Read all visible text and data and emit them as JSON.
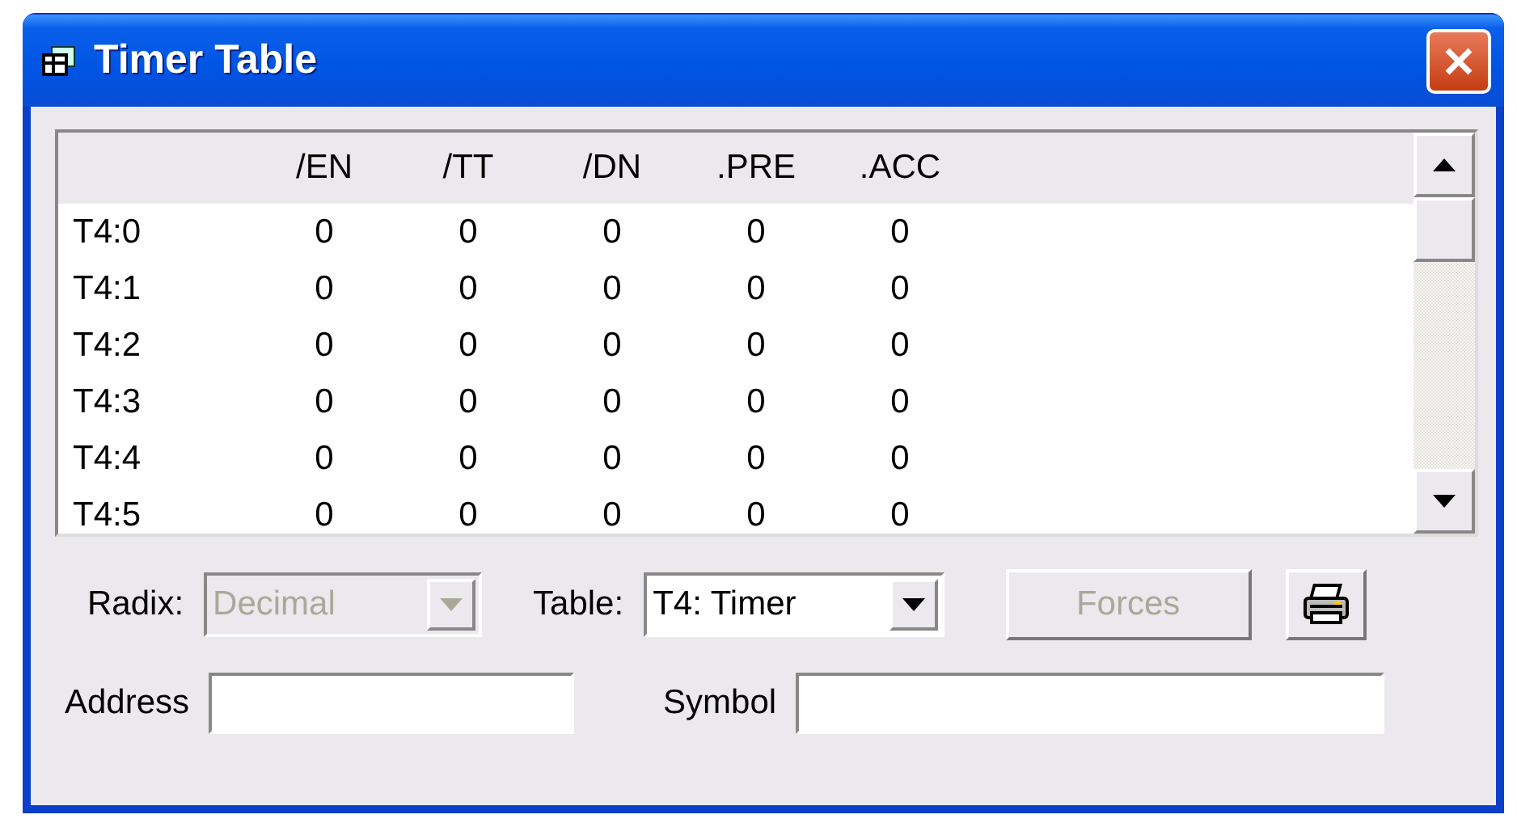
{
  "window": {
    "title": "Timer Table"
  },
  "table": {
    "columns": [
      "/EN",
      "/TT",
      "/DN",
      ".PRE",
      ".ACC"
    ],
    "rows": [
      {
        "address": "T4:0",
        "cells": [
          "0",
          "0",
          "0",
          "0",
          "0"
        ]
      },
      {
        "address": "T4:1",
        "cells": [
          "0",
          "0",
          "0",
          "0",
          "0"
        ]
      },
      {
        "address": "T4:2",
        "cells": [
          "0",
          "0",
          "0",
          "0",
          "0"
        ]
      },
      {
        "address": "T4:3",
        "cells": [
          "0",
          "0",
          "0",
          "0",
          "0"
        ]
      },
      {
        "address": "T4:4",
        "cells": [
          "0",
          "0",
          "0",
          "0",
          "0"
        ]
      },
      {
        "address": "T4:5",
        "cells": [
          "0",
          "0",
          "0",
          "0",
          "0"
        ]
      }
    ]
  },
  "controls": [
    {
      "kind": "dropdown",
      "label": "Radix:",
      "value": "Decimal",
      "disabled": true
    },
    {
      "kind": "dropdown",
      "label": "Table:",
      "value": "T4: Timer",
      "disabled": false
    },
    {
      "kind": "button",
      "label": "Forces",
      "disabled": true
    },
    {
      "kind": "print",
      "disabled": false
    }
  ],
  "fields": [
    {
      "label": "Address"
    },
    {
      "label": "Symbol"
    }
  ]
}
